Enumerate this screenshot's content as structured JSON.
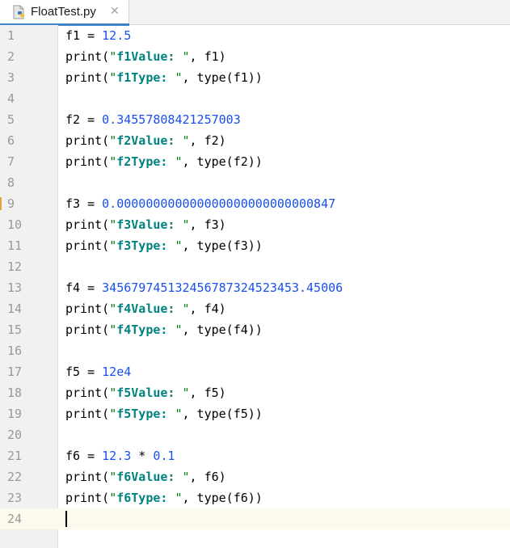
{
  "tab": {
    "filename": "FloatTest.py",
    "close_glyph": "✕",
    "icon": "python-file-icon"
  },
  "colors": {
    "number": "#1750eb",
    "string": "#067d17",
    "format_text": "#00827f",
    "current_line": "#fcfaed",
    "tab_accent": "#4083c9"
  },
  "editor": {
    "current_line": 24,
    "lines": [
      {
        "n": "1",
        "tokens": [
          {
            "t": "f1 = "
          },
          {
            "t": "12.5",
            "c": "num"
          }
        ]
      },
      {
        "n": "2",
        "tokens": [
          {
            "t": "print("
          },
          {
            "t": "\"",
            "c": "str"
          },
          {
            "t": "f1Value:",
            "c": "fmt"
          },
          {
            "t": " \"",
            "c": "str"
          },
          {
            "t": ", f1)"
          }
        ]
      },
      {
        "n": "3",
        "tokens": [
          {
            "t": "print("
          },
          {
            "t": "\"",
            "c": "str"
          },
          {
            "t": "f1Type:",
            "c": "fmt"
          },
          {
            "t": " \"",
            "c": "str"
          },
          {
            "t": ", type(f1))"
          }
        ]
      },
      {
        "n": "4",
        "tokens": []
      },
      {
        "n": "5",
        "tokens": [
          {
            "t": "f2 = "
          },
          {
            "t": "0.34557808421257003",
            "c": "num"
          }
        ]
      },
      {
        "n": "6",
        "tokens": [
          {
            "t": "print("
          },
          {
            "t": "\"",
            "c": "str"
          },
          {
            "t": "f2Value:",
            "c": "fmt"
          },
          {
            "t": " \"",
            "c": "str"
          },
          {
            "t": ", f2)"
          }
        ]
      },
      {
        "n": "7",
        "tokens": [
          {
            "t": "print("
          },
          {
            "t": "\"",
            "c": "str"
          },
          {
            "t": "f2Type:",
            "c": "fmt"
          },
          {
            "t": " \"",
            "c": "str"
          },
          {
            "t": ", type(f2))"
          }
        ]
      },
      {
        "n": "8",
        "tokens": []
      },
      {
        "n": "9",
        "tokens": [
          {
            "t": "f3 = "
          },
          {
            "t": "0.000000000000000000000000000847",
            "c": "num"
          }
        ]
      },
      {
        "n": "10",
        "tokens": [
          {
            "t": "print("
          },
          {
            "t": "\"",
            "c": "str"
          },
          {
            "t": "f3Value:",
            "c": "fmt"
          },
          {
            "t": " \"",
            "c": "str"
          },
          {
            "t": ", f3)"
          }
        ]
      },
      {
        "n": "11",
        "tokens": [
          {
            "t": "print("
          },
          {
            "t": "\"",
            "c": "str"
          },
          {
            "t": "f3Type:",
            "c": "fmt"
          },
          {
            "t": " \"",
            "c": "str"
          },
          {
            "t": ", type(f3))"
          }
        ]
      },
      {
        "n": "12",
        "tokens": []
      },
      {
        "n": "13",
        "tokens": [
          {
            "t": "f4 = "
          },
          {
            "t": "345679745132456787324523453.45006",
            "c": "num"
          }
        ]
      },
      {
        "n": "14",
        "tokens": [
          {
            "t": "print("
          },
          {
            "t": "\"",
            "c": "str"
          },
          {
            "t": "f4Value:",
            "c": "fmt"
          },
          {
            "t": " \"",
            "c": "str"
          },
          {
            "t": ", f4)"
          }
        ]
      },
      {
        "n": "15",
        "tokens": [
          {
            "t": "print("
          },
          {
            "t": "\"",
            "c": "str"
          },
          {
            "t": "f4Type:",
            "c": "fmt"
          },
          {
            "t": " \"",
            "c": "str"
          },
          {
            "t": ", type(f4))"
          }
        ]
      },
      {
        "n": "16",
        "tokens": []
      },
      {
        "n": "17",
        "tokens": [
          {
            "t": "f5 = "
          },
          {
            "t": "12e4",
            "c": "num"
          }
        ]
      },
      {
        "n": "18",
        "tokens": [
          {
            "t": "print("
          },
          {
            "t": "\"",
            "c": "str"
          },
          {
            "t": "f5Value:",
            "c": "fmt"
          },
          {
            "t": " \"",
            "c": "str"
          },
          {
            "t": ", f5)"
          }
        ]
      },
      {
        "n": "19",
        "tokens": [
          {
            "t": "print("
          },
          {
            "t": "\"",
            "c": "str"
          },
          {
            "t": "f5Type:",
            "c": "fmt"
          },
          {
            "t": " \"",
            "c": "str"
          },
          {
            "t": ", type(f5))"
          }
        ]
      },
      {
        "n": "20",
        "tokens": []
      },
      {
        "n": "21",
        "tokens": [
          {
            "t": "f6 = "
          },
          {
            "t": "12.3",
            "c": "num"
          },
          {
            "t": " * "
          },
          {
            "t": "0.1",
            "c": "num"
          }
        ]
      },
      {
        "n": "22",
        "tokens": [
          {
            "t": "print("
          },
          {
            "t": "\"",
            "c": "str"
          },
          {
            "t": "f6Value:",
            "c": "fmt"
          },
          {
            "t": " \"",
            "c": "str"
          },
          {
            "t": ", f6)"
          }
        ]
      },
      {
        "n": "23",
        "tokens": [
          {
            "t": "print("
          },
          {
            "t": "\"",
            "c": "str"
          },
          {
            "t": "f6Type:",
            "c": "fmt"
          },
          {
            "t": " \"",
            "c": "str"
          },
          {
            "t": ", type(f6))"
          }
        ]
      },
      {
        "n": "24",
        "tokens": []
      }
    ]
  }
}
